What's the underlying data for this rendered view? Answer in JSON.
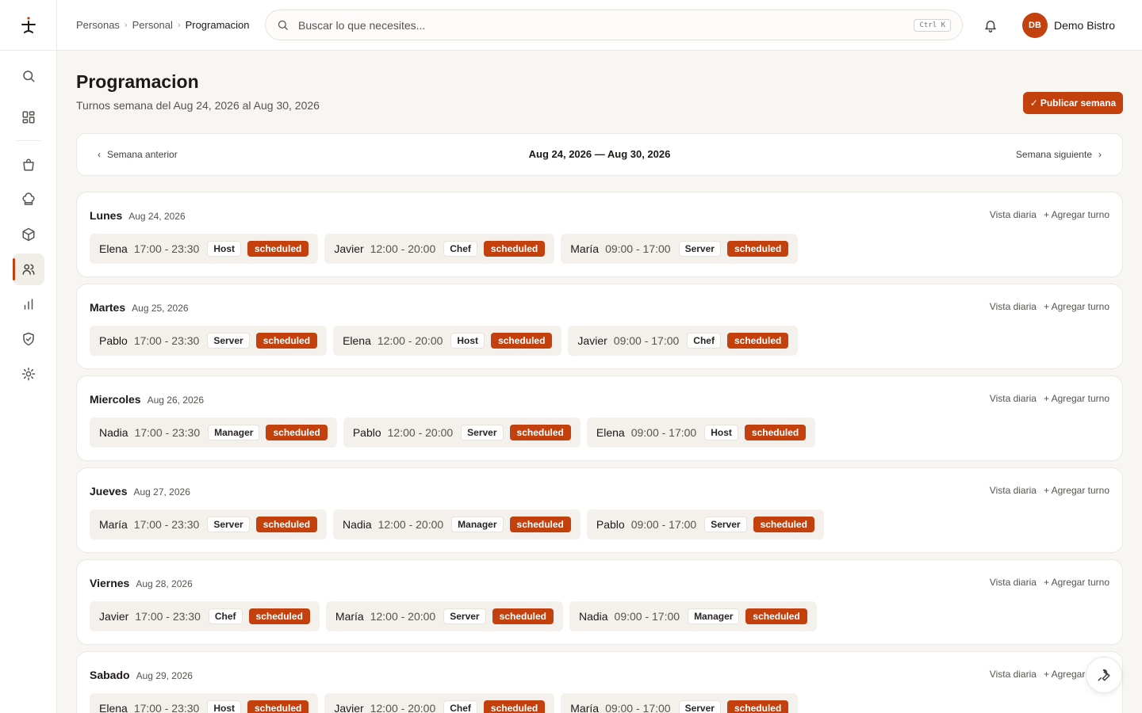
{
  "breadcrumb": [
    "Personas",
    "Personal",
    "Programacion"
  ],
  "search": {
    "placeholder": "Buscar lo que necesites...",
    "shortcut": "Ctrl K"
  },
  "user": {
    "initials": "DB",
    "name": "Demo Bistro"
  },
  "page": {
    "title": "Programacion",
    "subtitle": "Turnos semana del Aug 24, 2026 al Aug 30, 2026",
    "publish_label": "Publicar semana"
  },
  "week_nav": {
    "prev_label": "Semana anterior",
    "range": "Aug 24, 2026 — Aug 30, 2026",
    "next_label": "Semana siguiente"
  },
  "day_actions": {
    "daily_view": "Vista diaria",
    "add_shift": "+ Agregar turno"
  },
  "colors": {
    "accent": "#c2410c",
    "background": "#f8f6f3"
  },
  "days": [
    {
      "name": "Lunes",
      "date": "Aug 24, 2026",
      "shifts": [
        {
          "name": "Elena",
          "time": "17:00 - 23:30",
          "role": "Host",
          "status": "scheduled"
        },
        {
          "name": "Javier",
          "time": "12:00 - 20:00",
          "role": "Chef",
          "status": "scheduled"
        },
        {
          "name": "María",
          "time": "09:00 - 17:00",
          "role": "Server",
          "status": "scheduled"
        }
      ]
    },
    {
      "name": "Martes",
      "date": "Aug 25, 2026",
      "shifts": [
        {
          "name": "Pablo",
          "time": "17:00 - 23:30",
          "role": "Server",
          "status": "scheduled"
        },
        {
          "name": "Elena",
          "time": "12:00 - 20:00",
          "role": "Host",
          "status": "scheduled"
        },
        {
          "name": "Javier",
          "time": "09:00 - 17:00",
          "role": "Chef",
          "status": "scheduled"
        }
      ]
    },
    {
      "name": "Miercoles",
      "date": "Aug 26, 2026",
      "shifts": [
        {
          "name": "Nadia",
          "time": "17:00 - 23:30",
          "role": "Manager",
          "status": "scheduled"
        },
        {
          "name": "Pablo",
          "time": "12:00 - 20:00",
          "role": "Server",
          "status": "scheduled"
        },
        {
          "name": "Elena",
          "time": "09:00 - 17:00",
          "role": "Host",
          "status": "scheduled"
        }
      ]
    },
    {
      "name": "Jueves",
      "date": "Aug 27, 2026",
      "shifts": [
        {
          "name": "María",
          "time": "17:00 - 23:30",
          "role": "Server",
          "status": "scheduled"
        },
        {
          "name": "Nadia",
          "time": "12:00 - 20:00",
          "role": "Manager",
          "status": "scheduled"
        },
        {
          "name": "Pablo",
          "time": "09:00 - 17:00",
          "role": "Server",
          "status": "scheduled"
        }
      ]
    },
    {
      "name": "Viernes",
      "date": "Aug 28, 2026",
      "shifts": [
        {
          "name": "Javier",
          "time": "17:00 - 23:30",
          "role": "Chef",
          "status": "scheduled"
        },
        {
          "name": "María",
          "time": "12:00 - 20:00",
          "role": "Server",
          "status": "scheduled"
        },
        {
          "name": "Nadia",
          "time": "09:00 - 17:00",
          "role": "Manager",
          "status": "scheduled"
        }
      ]
    },
    {
      "name": "Sabado",
      "date": "Aug 29, 2026",
      "shifts": [
        {
          "name": "Elena",
          "time": "17:00 - 23:30",
          "role": "Host",
          "status": "scheduled"
        },
        {
          "name": "Javier",
          "time": "12:00 - 20:00",
          "role": "Chef",
          "status": "scheduled"
        },
        {
          "name": "María",
          "time": "09:00 - 17:00",
          "role": "Server",
          "status": "scheduled"
        }
      ]
    }
  ]
}
